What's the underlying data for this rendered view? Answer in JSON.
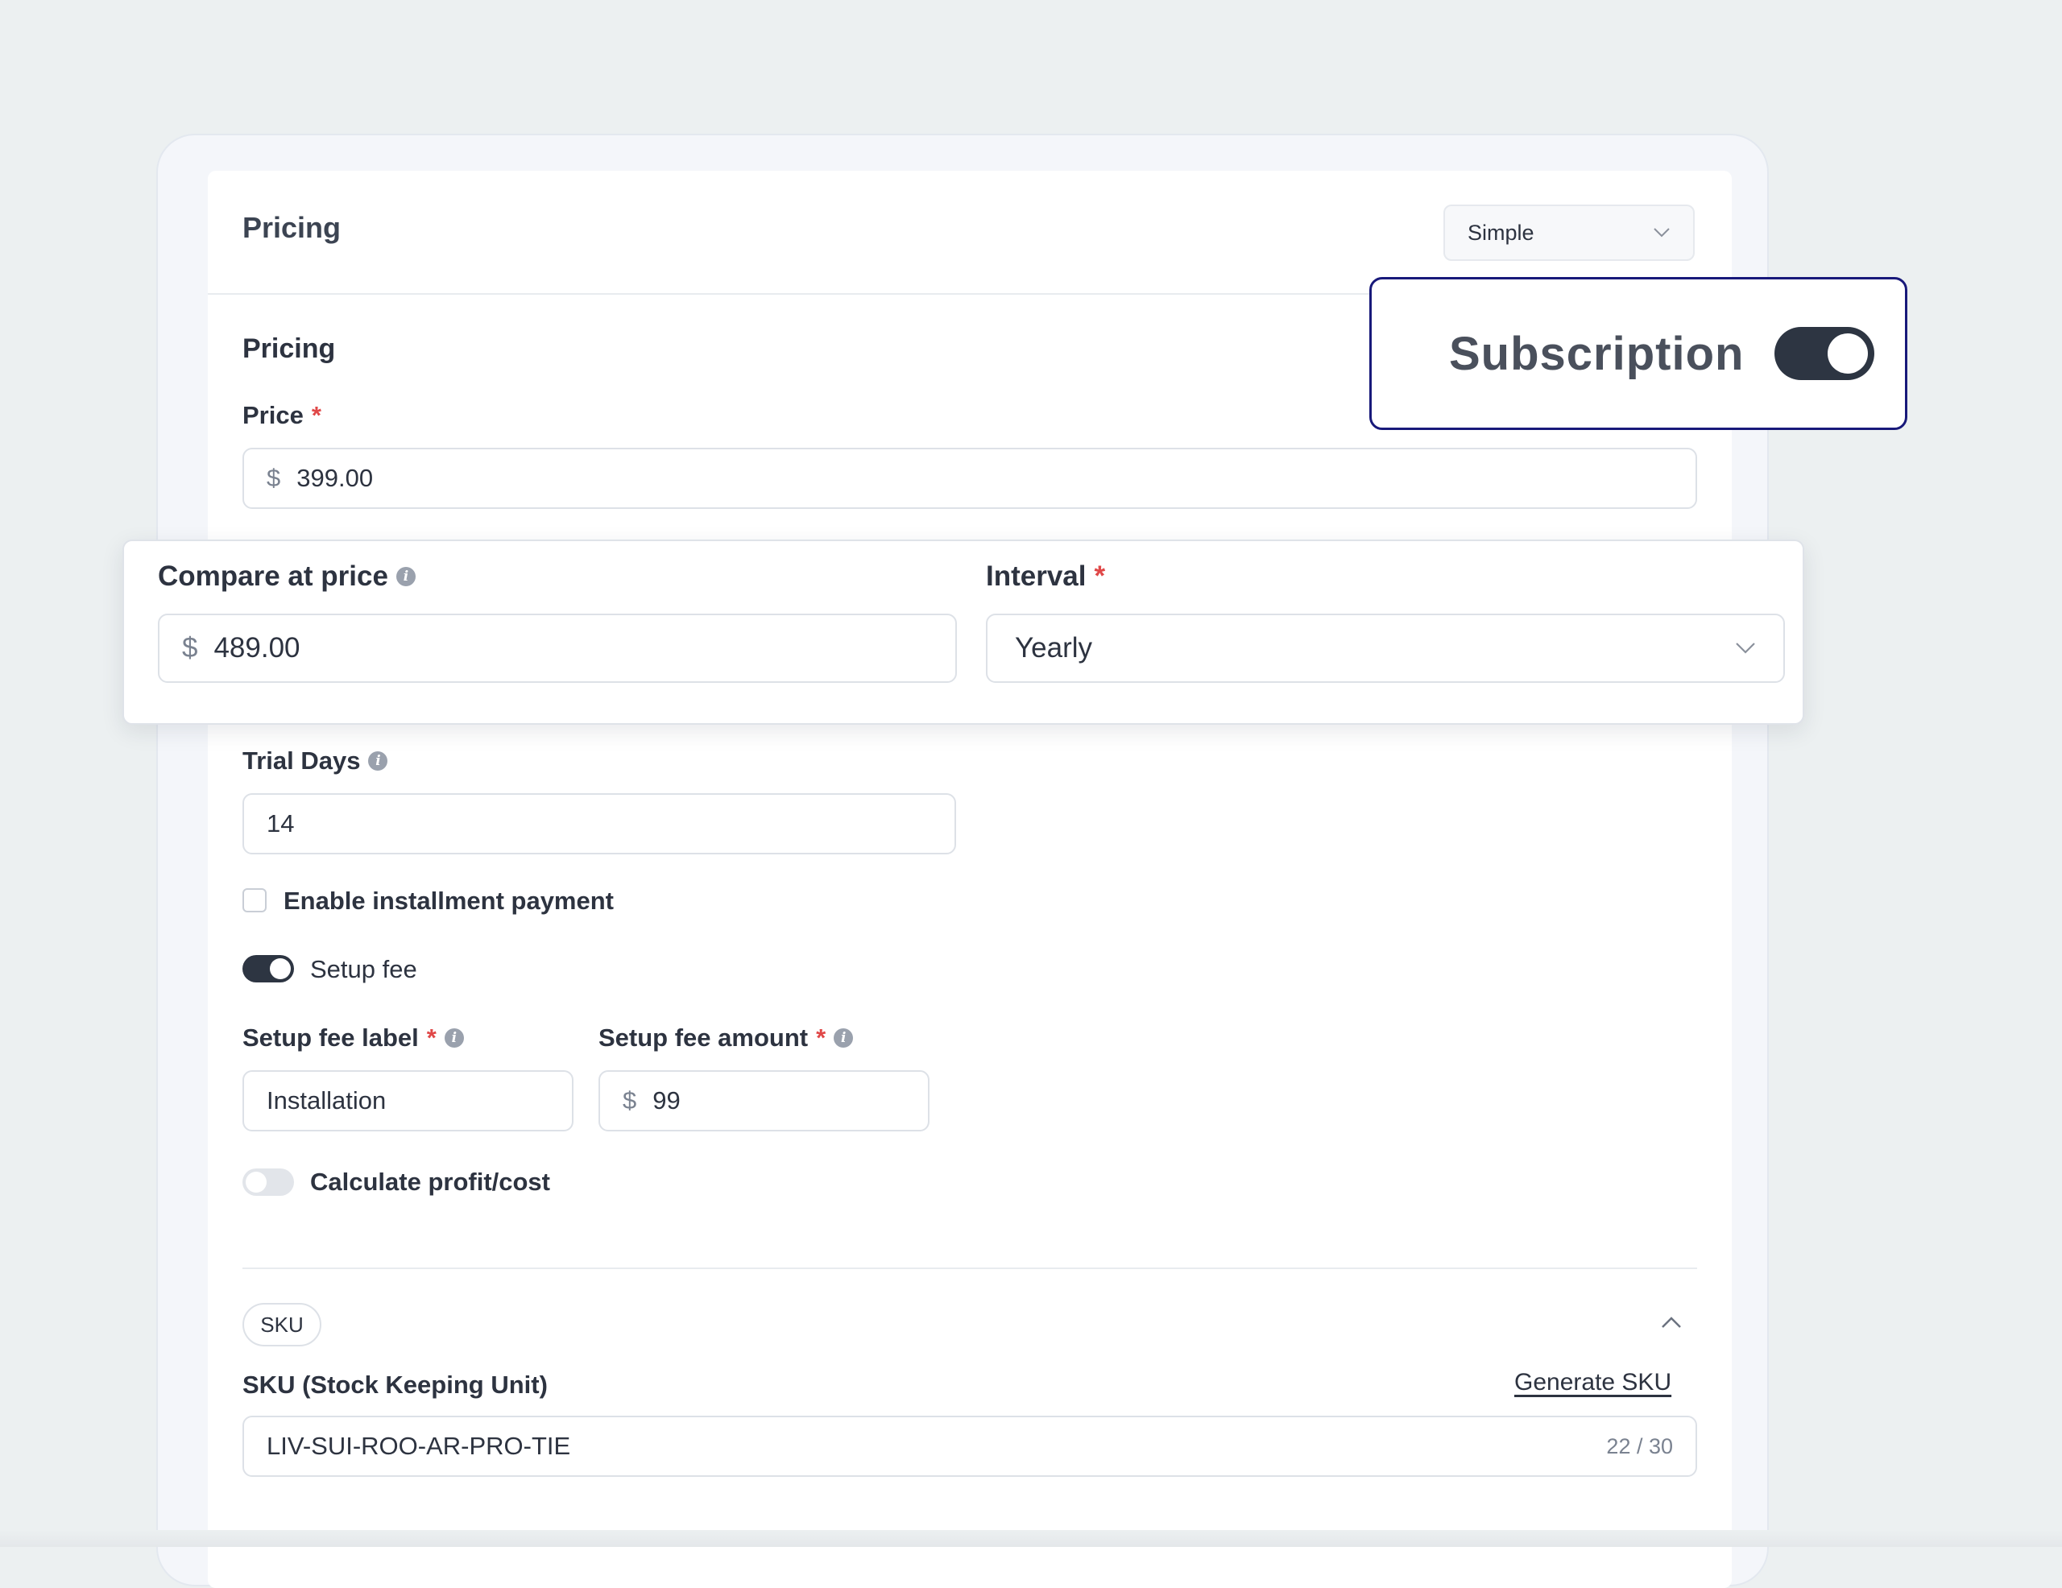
{
  "header": {
    "title": "Pricing",
    "type_select": "Simple"
  },
  "subscription": {
    "label": "Subscription",
    "enabled": true
  },
  "section": {
    "title": "Pricing"
  },
  "price": {
    "label": "Price",
    "required_mark": "*",
    "currency": "$",
    "value": "399.00"
  },
  "compare_at_price": {
    "label": "Compare at price",
    "currency": "$",
    "value": "489.00"
  },
  "interval": {
    "label": "Interval",
    "required_mark": "*",
    "value": "Yearly"
  },
  "trial_days": {
    "label": "Trial Days",
    "value": "14"
  },
  "installment": {
    "label": "Enable installment payment",
    "checked": false
  },
  "setup_fee": {
    "label": "Setup fee",
    "enabled": true
  },
  "setup_fee_label": {
    "label": "Setup fee label",
    "required_mark": "*",
    "value": "Installation"
  },
  "setup_fee_amount": {
    "label": "Setup fee amount",
    "required_mark": "*",
    "currency": "$",
    "value": "99"
  },
  "profit_cost": {
    "label": "Calculate profit/cost",
    "enabled": false
  },
  "sku": {
    "pill": "SKU",
    "label": "SKU (Stock Keeping Unit)",
    "generate_link": "Generate SKU",
    "value": "LIV-SUI-ROO-AR-PRO-TIE",
    "counter": "22 / 30"
  },
  "info_glyph": "i",
  "colors": {
    "accent_dark": "#2d3542",
    "required": "#e04848",
    "highlight_border": "#18197a"
  }
}
